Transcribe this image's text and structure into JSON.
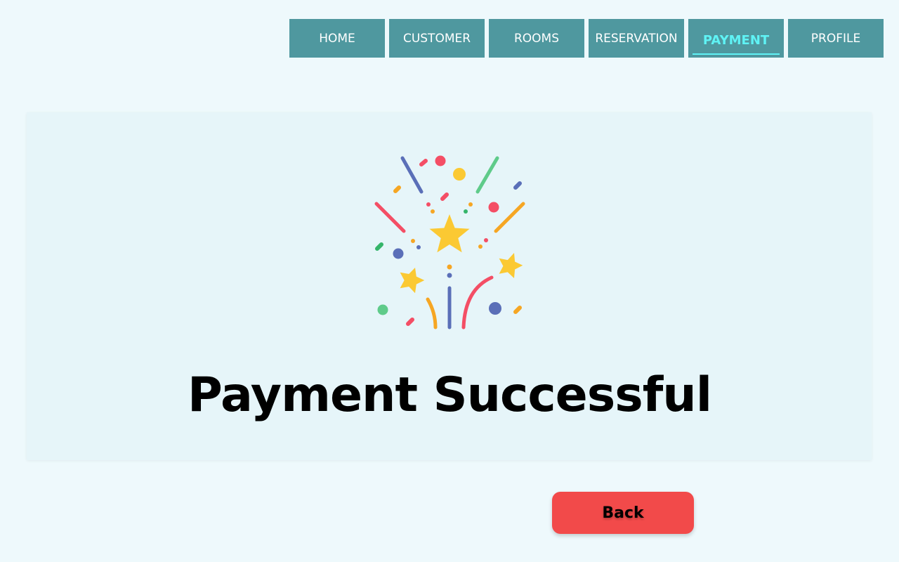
{
  "nav": {
    "items": [
      {
        "label": "HOME",
        "active": false
      },
      {
        "label": "CUSTOMER",
        "active": false
      },
      {
        "label": "ROOMS",
        "active": false
      },
      {
        "label": "RESERVATION",
        "active": false
      },
      {
        "label": "PAYMENT",
        "active": true
      },
      {
        "label": "PROFILE",
        "active": false
      }
    ],
    "bg_color": "#4f989f",
    "active_color": "#5ff3f5"
  },
  "main": {
    "icon": "confetti-celebration-icon",
    "title": "Payment Successful"
  },
  "back_button": {
    "label": "Back",
    "color": "#f24a4a"
  }
}
